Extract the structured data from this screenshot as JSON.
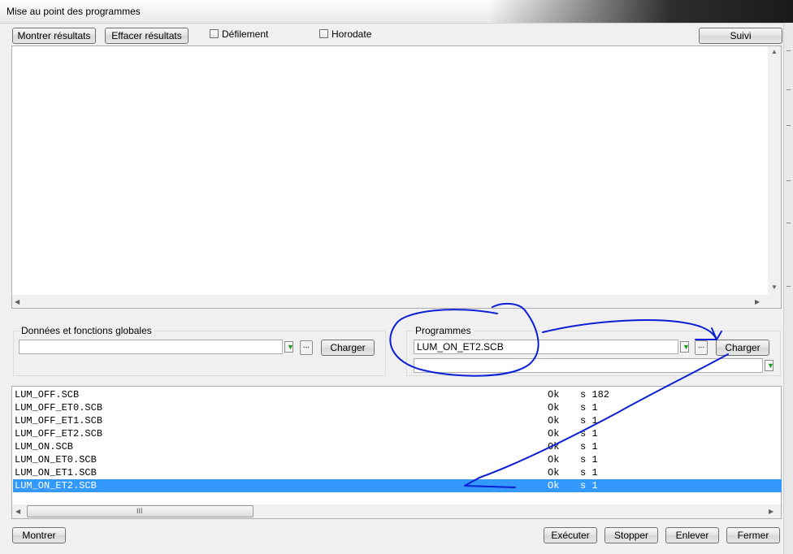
{
  "window": {
    "title": "Mise au point des programmes"
  },
  "toolbar": {
    "show_results": "Montrer résultats",
    "clear_results": "Effacer résultats",
    "scroll_label": "Défilement",
    "timestamp_label": "Horodate",
    "follow": "Suivi"
  },
  "globals": {
    "label": "Données et fonctions globales",
    "value": "",
    "browse": "...",
    "load": "Charger"
  },
  "programs": {
    "label": "Programmes",
    "value": "LUM_ON_ET2.SCB",
    "browse": "...",
    "load": "Charger",
    "second_value": ""
  },
  "list": {
    "rows": [
      {
        "name": "LUM_OFF.SCB",
        "status": "Ok",
        "info": "s 182"
      },
      {
        "name": "LUM_OFF_ET0.SCB",
        "status": "Ok",
        "info": "s 1"
      },
      {
        "name": "LUM_OFF_ET1.SCB",
        "status": "Ok",
        "info": "s 1"
      },
      {
        "name": "LUM_OFF_ET2.SCB",
        "status": "Ok",
        "info": "s 1"
      },
      {
        "name": "LUM_ON.SCB",
        "status": "Ok",
        "info": "s 1"
      },
      {
        "name": "LUM_ON_ET0.SCB",
        "status": "Ok",
        "info": "s 1"
      },
      {
        "name": "LUM_ON_ET1.SCB",
        "status": "Ok",
        "info": "s 1"
      },
      {
        "name": "LUM_ON_ET2.SCB",
        "status": "Ok",
        "info": "s 1"
      }
    ],
    "selected_index": 7,
    "scroll_grip": "III"
  },
  "footer": {
    "show": "Montrer",
    "execute": "Exécuter",
    "stop": "Stopper",
    "remove": "Enlever",
    "close": "Fermer"
  },
  "colors": {
    "selection": "#3399ff",
    "annotation": "#0a1fd6",
    "download_arrow": "#1a9a1a"
  },
  "icons": {
    "download": "download-arrow-icon",
    "scroll_up": "arrow-up-icon",
    "scroll_down": "arrow-down-icon",
    "scroll_left": "arrow-left-icon",
    "scroll_right": "arrow-right-icon"
  }
}
